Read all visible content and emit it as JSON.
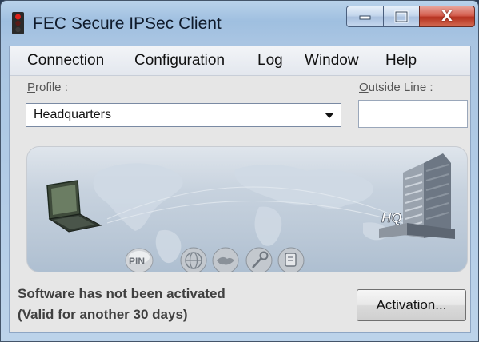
{
  "window": {
    "title": "FEC Secure IPSec Client"
  },
  "titlebar_buttons": {
    "minimize_icon": "minimize-icon",
    "maximize_icon": "maximize-icon",
    "close_icon": "close-icon",
    "close_label": "X"
  },
  "menubar": {
    "items": [
      {
        "pre": "C",
        "key": "o",
        "post": "nnection"
      },
      {
        "pre": "Con",
        "key": "f",
        "post": "iguration"
      },
      {
        "pre": "",
        "key": "L",
        "post": "og"
      },
      {
        "pre": "",
        "key": "W",
        "post": "indow"
      },
      {
        "pre": "",
        "key": "H",
        "post": "elp"
      }
    ]
  },
  "profile": {
    "label_key": "P",
    "label_rest": "rofile :",
    "selected": "Headquarters"
  },
  "outside_line": {
    "label_key": "O",
    "label_rest": "utside Line :",
    "value": ""
  },
  "map_panel": {
    "hq_label": "HQ",
    "icons": [
      "laptop-icon",
      "building-icon",
      "pin-icon",
      "globe-icon",
      "handshake-icon",
      "key-icon",
      "certificate-icon"
    ],
    "pin_label": "PIN"
  },
  "status": {
    "line1": "Software has not been activated",
    "line2": "(Valid for another 30 days)"
  },
  "buttons": {
    "activation": "Activation..."
  },
  "colors": {
    "close_button": "#c9432f",
    "title_bar": "#a9c5e2"
  }
}
